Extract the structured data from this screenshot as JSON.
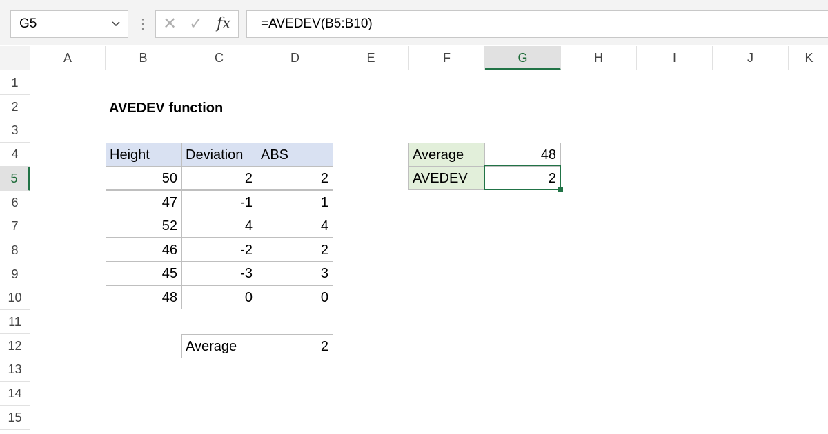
{
  "formula_bar": {
    "name_box": "G5",
    "name_box_chevron": "chevron-down-icon",
    "separator": "⋮",
    "cancel_icon": "✕",
    "enter_icon": "✓",
    "fx_label": "fx",
    "formula": "=AVEDEV(B5:B10)"
  },
  "grid": {
    "columns": [
      "A",
      "B",
      "C",
      "D",
      "E",
      "F",
      "G",
      "H",
      "I",
      "J",
      "K"
    ],
    "rows": [
      "1",
      "2",
      "3",
      "4",
      "5",
      "6",
      "7",
      "8",
      "9",
      "10",
      "11",
      "12",
      "13",
      "14",
      "15"
    ],
    "selected_column": "G",
    "selected_row": "5"
  },
  "sheet": {
    "title": "AVEDEV function",
    "table_headers": [
      "Height",
      "Deviation",
      "ABS"
    ],
    "table_rows": [
      {
        "height": "50",
        "deviation": "2",
        "abs": "2"
      },
      {
        "height": "47",
        "deviation": "-1",
        "abs": "1"
      },
      {
        "height": "52",
        "deviation": "4",
        "abs": "4"
      },
      {
        "height": "46",
        "deviation": "-2",
        "abs": "2"
      },
      {
        "height": "45",
        "deviation": "-3",
        "abs": "3"
      },
      {
        "height": "48",
        "deviation": "0",
        "abs": "0"
      }
    ],
    "summary_label": "Average",
    "summary_value": "2",
    "results": {
      "average_label": "Average",
      "average_value": "48",
      "avedev_label": "AVEDEV",
      "avedev_value": "2"
    }
  },
  "colors": {
    "header_blue": "#d9e1f2",
    "header_green": "#e2efda",
    "selection": "#217346"
  }
}
